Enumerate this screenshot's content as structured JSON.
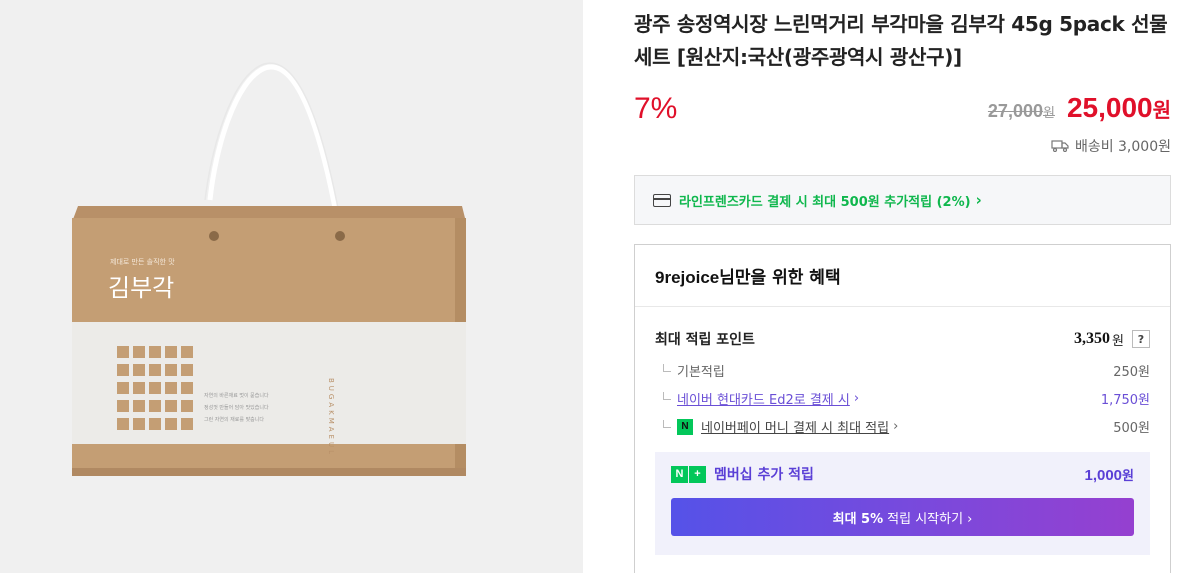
{
  "product": {
    "title": "광주 송정역시장 느린먹거리 부각마을 김부각 45g 5pack 선물세트 [원산지:국산(광주광역시 광산구)]",
    "image": {
      "box_tagline": "제대로 만든 솔직한 맛",
      "box_brand": "김부각",
      "box_side_text": "BUGAKMAEUL",
      "box_desc_lines": [
        "자연의 바른재료 멋이 묻습니다",
        "정성껏 만들어 담아 맛있습니다",
        "그런 자연의 재료를 맞춥니다"
      ]
    }
  },
  "price": {
    "discount": "7%",
    "original": "27,000",
    "original_unit": "원",
    "sale": "25,000",
    "sale_unit": "원"
  },
  "shipping": {
    "label": "배송비 3,000원",
    "icon": "truck-icon"
  },
  "card_benefit": {
    "text": "라인프렌즈카드 결제 시 최대 500원 추가적립 (2%)",
    "chevron": "›",
    "icon": "card-icon"
  },
  "benefits": {
    "user": "9rejoice",
    "title_suffix": "님만을 위한 혜택",
    "max_points_label": "최대 적립 포인트",
    "max_points_value": "3,350",
    "max_points_unit": "원",
    "help": "?",
    "rows": [
      {
        "label": "기본적립",
        "value": "250원"
      },
      {
        "label": "네이버 현대카드 Ed2로 결제 시",
        "value": "1,750원",
        "chevron": "›"
      },
      {
        "label": "네이버페이 머니 결제 시 최대 적립",
        "value": "500원",
        "chevron": "›",
        "badge": "N"
      }
    ],
    "membership": {
      "badge_n": "N",
      "badge_plus": "+",
      "label": "멤버십 추가 적립",
      "value": "1,000",
      "unit": "원",
      "button_bold": "최대 5%",
      "button_rest": "적립 시작하기 ›"
    }
  },
  "colors": {
    "accent_red": "#e0102a",
    "accent_green": "#0fb74d",
    "accent_purple": "#6a4fd6",
    "box_kraft": "#c19c72",
    "box_panel": "#ececea"
  }
}
